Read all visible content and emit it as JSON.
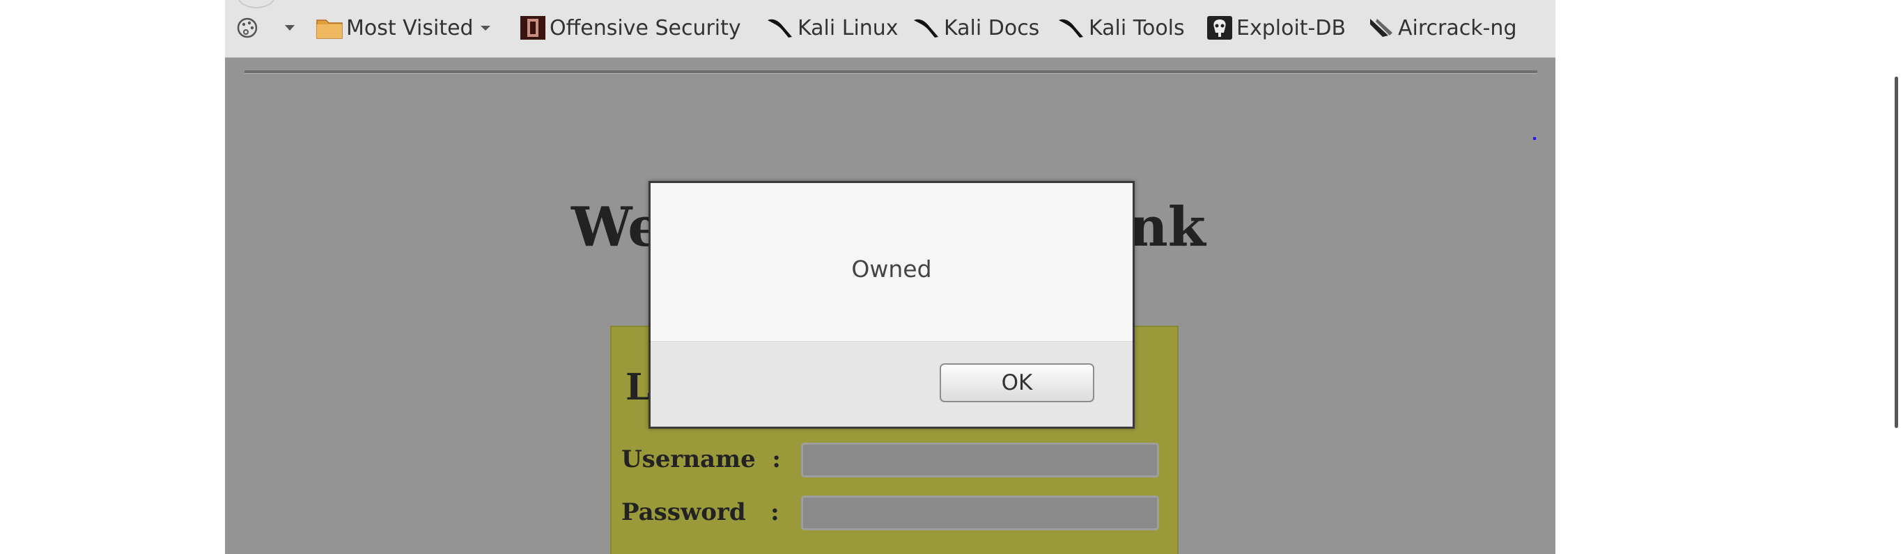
{
  "toolbar": {
    "most_visited": "Most Visited",
    "bookmarks": [
      {
        "label": "Offensive Security",
        "icon": "offsec-icon"
      },
      {
        "label": "Kali Linux",
        "icon": "kali-dragon-icon"
      },
      {
        "label": "Kali Docs",
        "icon": "kali-dragon-icon"
      },
      {
        "label": "Kali Tools",
        "icon": "kali-dragon-icon"
      },
      {
        "label": "Exploit-DB",
        "icon": "exploit-db-icon"
      },
      {
        "label": "Aircrack-ng",
        "icon": "aircrack-icon"
      }
    ]
  },
  "page": {
    "heading_left": "We",
    "heading_right": "nk",
    "login_letter": "L",
    "username_label": "Username  :",
    "password_label": "Password   :",
    "username_value": "",
    "password_value": ""
  },
  "dialog": {
    "message": "Owned",
    "ok_label": "OK"
  },
  "colors": {
    "page_background": "#949494",
    "login_box": "#9a9a3a",
    "dialog_background": "#f6f6f6"
  }
}
